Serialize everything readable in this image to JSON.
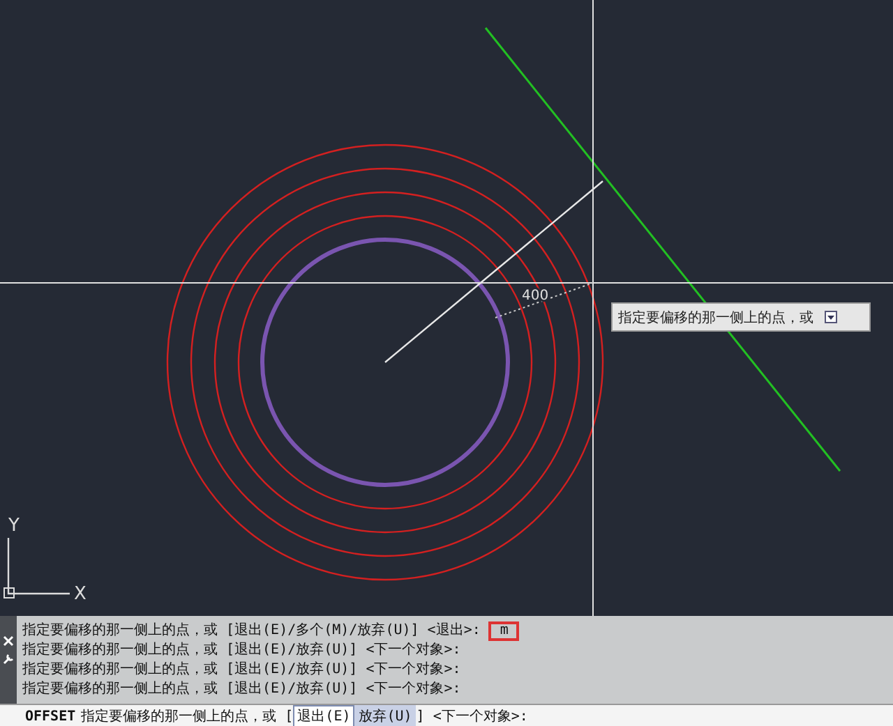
{
  "drawing": {
    "dimension_value": "400",
    "tooltip": {
      "text": "指定要偏移的那一侧上的点，或"
    },
    "ucs": {
      "y_label": "Y",
      "x_label": "X"
    }
  },
  "command_history": [
    {
      "text": "指定要偏移的那一侧上的点，或 [退出(E)/多个(M)/放弃(U)] <退出>:",
      "input": "m"
    },
    {
      "text": "指定要偏移的那一侧上的点，或 [退出(E)/放弃(U)] <下一个对象>:"
    },
    {
      "text": "指定要偏移的那一侧上的点，或 [退出(E)/放弃(U)] <下一个对象>:"
    },
    {
      "text": "指定要偏移的那一侧上的点，或 [退出(E)/放弃(U)] <下一个对象>:"
    }
  ],
  "command_line": {
    "command": "OFFSET",
    "prompt": "指定要偏移的那一侧上的点，或 [",
    "options": [
      {
        "label": "退出(E)",
        "selected": true
      },
      {
        "label": "放弃(U)",
        "selected": false
      }
    ],
    "suffix": "] <下一个对象>:"
  }
}
